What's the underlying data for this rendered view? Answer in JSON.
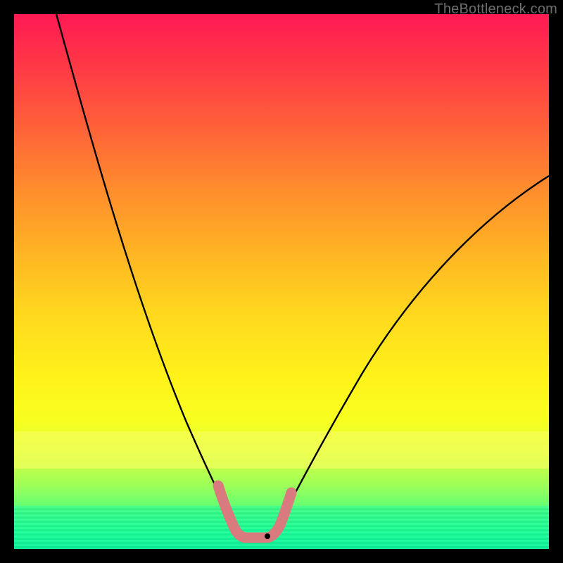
{
  "watermark": {
    "text": "TheBottleneck.com"
  },
  "chart_data": {
    "type": "line",
    "title": "",
    "xlabel": "",
    "ylabel": "",
    "xlim": [
      0,
      100
    ],
    "ylim": [
      0,
      100
    ],
    "grid": false,
    "legend": false,
    "series": [
      {
        "name": "left-curve",
        "x": [
          8,
          12,
          16,
          20,
          24,
          28,
          32,
          36,
          38,
          40,
          42
        ],
        "values": [
          100,
          85,
          70,
          56,
          44,
          33,
          23,
          14,
          9,
          5,
          2
        ]
      },
      {
        "name": "right-curve",
        "x": [
          48,
          50,
          52,
          56,
          62,
          70,
          80,
          90,
          100
        ],
        "values": [
          2,
          5,
          9,
          17,
          28,
          40,
          52,
          62,
          70
        ]
      },
      {
        "name": "bottom-marker",
        "x": [
          38,
          40,
          42,
          44,
          46,
          48,
          50
        ],
        "values": [
          9,
          4,
          2,
          2,
          2,
          4,
          9
        ]
      }
    ],
    "colors": {
      "curve": "#000000",
      "marker": "#d97b7e"
    }
  }
}
